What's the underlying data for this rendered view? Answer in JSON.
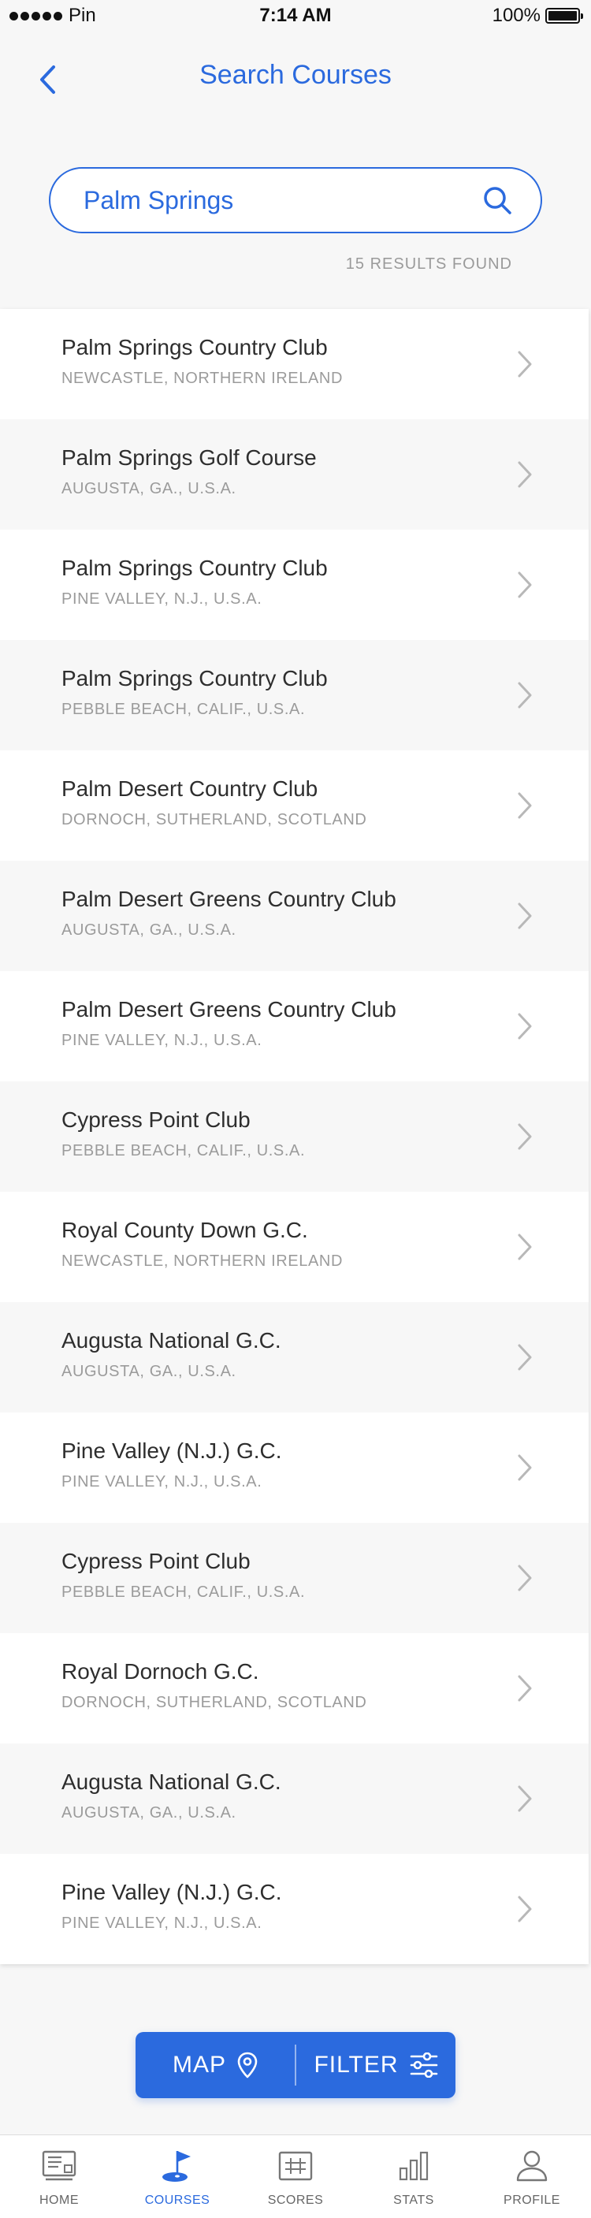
{
  "status_bar": {
    "carrier": "Pin",
    "time": "7:14 AM",
    "battery": "100%"
  },
  "header": {
    "title": "Search Courses",
    "back_icon": "chevron-left-icon"
  },
  "search": {
    "value": "Palm Springs",
    "placeholder": "",
    "results_text": "15 RESULTS FOUND"
  },
  "results": [
    {
      "name": "Palm Springs Country Club",
      "location": "NEWCASTLE, NORTHERN IRELAND"
    },
    {
      "name": "Palm Springs Golf Course",
      "location": "AUGUSTA, GA., U.S.A."
    },
    {
      "name": "Palm Springs Country Club",
      "location": "PINE VALLEY, N.J., U.S.A."
    },
    {
      "name": "Palm Springs Country Club",
      "location": "PEBBLE BEACH, CALIF., U.S.A."
    },
    {
      "name": "Palm Desert Country Club",
      "location": "DORNOCH, SUTHERLAND, SCOTLAND"
    },
    {
      "name": "Palm Desert Greens Country Club",
      "location": "AUGUSTA, GA., U.S.A."
    },
    {
      "name": "Palm Desert Greens Country Club",
      "location": "PINE VALLEY, N.J., U.S.A."
    },
    {
      "name": "Cypress Point Club",
      "location": "PEBBLE BEACH, CALIF., U.S.A."
    },
    {
      "name": "Royal County Down G.C.",
      "location": "NEWCASTLE, NORTHERN IRELAND"
    },
    {
      "name": "Augusta National G.C.",
      "location": "AUGUSTA, GA., U.S.A."
    },
    {
      "name": "Pine Valley (N.J.) G.C.",
      "location": "PINE VALLEY, N.J., U.S.A."
    },
    {
      "name": "Cypress Point Club",
      "location": "PEBBLE BEACH, CALIF., U.S.A."
    },
    {
      "name": "Royal Dornoch G.C.",
      "location": "DORNOCH, SUTHERLAND, SCOTLAND"
    },
    {
      "name": "Augusta National G.C.",
      "location": "AUGUSTA, GA., U.S.A."
    },
    {
      "name": "Pine Valley (N.J.) G.C.",
      "location": "PINE VALLEY, N.J., U.S.A."
    }
  ],
  "actions": {
    "map_label": "MAP",
    "filter_label": "FILTER"
  },
  "tabs": [
    {
      "label": "HOME",
      "icon": "home-icon",
      "active": false
    },
    {
      "label": "COURSES",
      "icon": "golf-flag-icon",
      "active": true
    },
    {
      "label": "SCORES",
      "icon": "scorecard-icon",
      "active": false
    },
    {
      "label": "STATS",
      "icon": "bar-chart-icon",
      "active": false
    },
    {
      "label": "PROFILE",
      "icon": "user-icon",
      "active": false
    }
  ],
  "colors": {
    "accent": "#2b6ade",
    "background": "#f7f7f7",
    "secondary_text": "#9b9b9b"
  }
}
